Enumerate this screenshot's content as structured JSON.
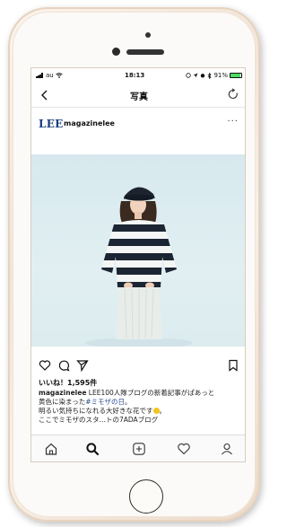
{
  "status_bar": {
    "carrier": "au",
    "time": "18:13",
    "battery_percent": "91%",
    "battery_level": 0.91
  },
  "nav": {
    "title": "写真"
  },
  "post": {
    "brand_logo": "LEE",
    "username": "magazinelee",
    "likes": "いいね！1,595件",
    "caption": {
      "author": "magazinelee",
      "line1": " LEE100人隊ブログの新着記事がぱあっと",
      "line2_a": "黄色に染まった",
      "hashtag": "#ミモザの日",
      "line2_b": "。",
      "line3": "明るい気持ちになれる大好きな花です",
      "line3_end": "。",
      "line4": "ここでミモザのスタ…トの7ADAブログ"
    }
  },
  "colors": {
    "brand_blue": "#1a3d7a",
    "hashtag_blue": "#2a4d8f",
    "battery_green": "#4cd964"
  },
  "icons": {
    "back": "chevron-left-icon",
    "refresh": "refresh-icon",
    "more": "more-horizontal-icon",
    "like": "heart-icon",
    "comment": "comment-icon",
    "share": "send-icon",
    "save": "bookmark-icon",
    "home": "home-icon",
    "search": "search-icon",
    "new_post": "add-post-icon",
    "activity": "heart-icon",
    "profile": "profile-icon"
  }
}
